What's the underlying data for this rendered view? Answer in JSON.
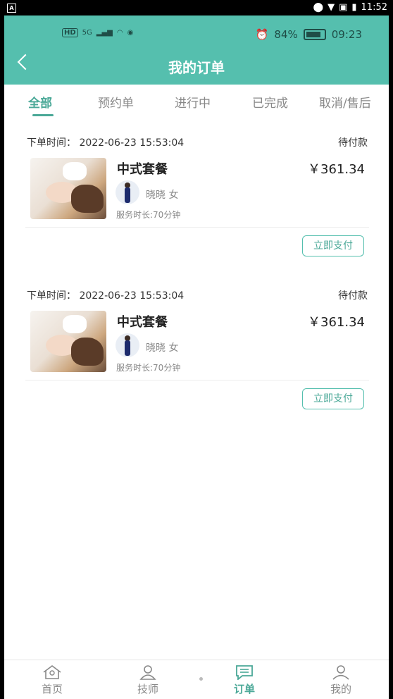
{
  "system_status": {
    "time": "11:52"
  },
  "inner_status": {
    "network": "5G",
    "hd": "HD",
    "battery": "84%",
    "time": "09:23"
  },
  "header": {
    "title": "我的订单"
  },
  "tabs": [
    {
      "label": "全部",
      "active": true
    },
    {
      "label": "预约单",
      "active": false
    },
    {
      "label": "进行中",
      "active": false
    },
    {
      "label": "已完成",
      "active": false
    },
    {
      "label": "取消/售后",
      "active": false
    }
  ],
  "orders": [
    {
      "order_time": "下单时间：  2022-06-23 15:53:04",
      "status": "待付款",
      "product": "中式套餐",
      "price": "￥361.34",
      "technician": "晓晓  女",
      "duration": "服务时长:70分钟",
      "action": "立即支付"
    },
    {
      "order_time": "下单时间：  2022-06-23 15:53:04",
      "status": "待付款",
      "product": "中式套餐",
      "price": "￥361.34",
      "technician": "晓晓  女",
      "duration": "服务时长:70分钟",
      "action": "立即支付"
    }
  ],
  "bottom_nav": [
    {
      "label": "首页",
      "icon": "home-icon",
      "active": false
    },
    {
      "label": "技师",
      "icon": "technician-icon",
      "active": false
    },
    {
      "label": "订单",
      "icon": "order-icon",
      "active": true
    },
    {
      "label": "我的",
      "icon": "profile-icon",
      "active": false
    }
  ],
  "colors": {
    "accent": "#55bfae",
    "active_text": "#4aa897"
  }
}
